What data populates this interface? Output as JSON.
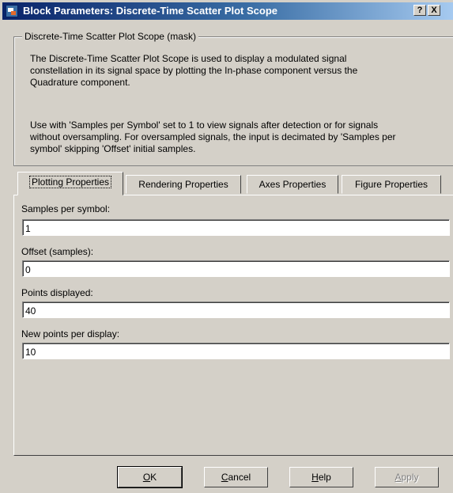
{
  "window": {
    "title": "Block Parameters: Discrete-Time Scatter Plot Scope",
    "help_button": "?",
    "close_button": "X"
  },
  "mask": {
    "group_title": "Discrete-Time Scatter Plot Scope (mask)",
    "description_1": "The Discrete-Time Scatter Plot Scope is used to display a modulated signal\nconstellation in its signal space by plotting the In-phase component versus the\nQuadrature component.",
    "description_2": "Use with 'Samples per Symbol' set to 1 to view signals after detection or for signals\nwithout oversampling.  For oversampled signals, the input is decimated by 'Samples per\nsymbol' skipping 'Offset' initial samples."
  },
  "tabs": [
    {
      "label": "Plotting Properties",
      "active": true
    },
    {
      "label": "Rendering Properties",
      "active": false
    },
    {
      "label": "Axes Properties",
      "active": false
    },
    {
      "label": "Figure Properties",
      "active": false
    }
  ],
  "fields": [
    {
      "label": "Samples per symbol:",
      "value": "1"
    },
    {
      "label": "Offset (samples):",
      "value": "0"
    },
    {
      "label": "Points displayed:",
      "value": "40"
    },
    {
      "label": "New points per display:",
      "value": "10"
    }
  ],
  "buttons": {
    "ok": {
      "mnemonic": "O",
      "rest": "K"
    },
    "cancel": {
      "mnemonic": "C",
      "rest": "ancel"
    },
    "help": {
      "mnemonic": "H",
      "rest": "elp"
    },
    "apply": {
      "mnemonic": "A",
      "rest": "pply"
    }
  }
}
